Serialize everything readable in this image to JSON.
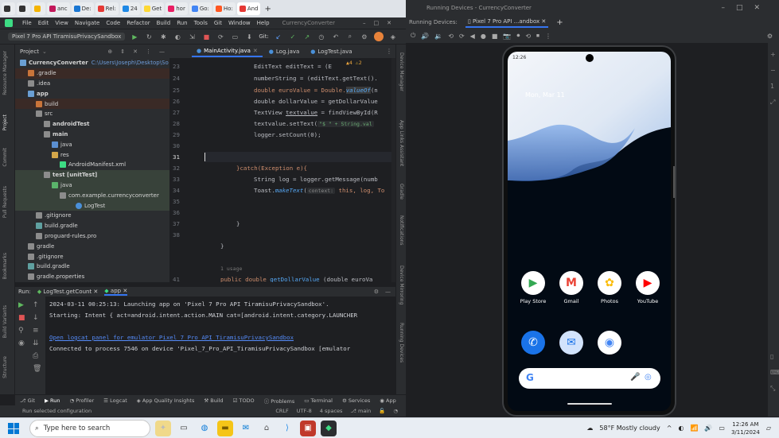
{
  "browser_tabs": [
    "anc",
    "De:",
    "Rel:",
    "24",
    "Get",
    "hor",
    "Go:",
    "Ho:",
    "And"
  ],
  "ide": {
    "menu": [
      "File",
      "Edit",
      "View",
      "Navigate",
      "Code",
      "Refactor",
      "Build",
      "Run",
      "Tools",
      "Git",
      "Window",
      "Help"
    ],
    "project_title": "CurrencyConverter",
    "device_selector": "Pixel 7 Pro API TiramisuPrivacySandbox",
    "git_label": "Git:",
    "project_panel_label": "Project",
    "tree": [
      {
        "label": "CurrencyConverter",
        "path": "C:\\Users\\Joseph\\Desktop\\So",
        "depth": 0
      },
      {
        "label": ".gradle",
        "depth": 1
      },
      {
        "label": ".idea",
        "depth": 1
      },
      {
        "label": "app",
        "depth": 1
      },
      {
        "label": "build",
        "depth": 2
      },
      {
        "label": "src",
        "depth": 2
      },
      {
        "label": "androidTest",
        "depth": 3
      },
      {
        "label": "main",
        "depth": 3
      },
      {
        "label": "java",
        "depth": 4
      },
      {
        "label": "res",
        "depth": 4
      },
      {
        "label": "AndroidManifest.xml",
        "depth": 4
      },
      {
        "label": "test [unitTest]",
        "depth": 3
      },
      {
        "label": "java",
        "depth": 4
      },
      {
        "label": "com.example.currencyconverter",
        "depth": 5
      },
      {
        "label": "LogTest",
        "depth": 6
      },
      {
        "label": ".gitignore",
        "depth": 2
      },
      {
        "label": "build.gradle",
        "depth": 2
      },
      {
        "label": "proguard-rules.pro",
        "depth": 2
      },
      {
        "label": "gradle",
        "depth": 1
      },
      {
        "label": ".gitignore",
        "depth": 1
      },
      {
        "label": "build.gradle",
        "depth": 1
      },
      {
        "label": "gradle.properties",
        "depth": 1
      }
    ],
    "editor_tabs": [
      "MainActivity.java",
      "Log.java",
      "LogTest.java"
    ],
    "inspection": {
      "warnings": "4",
      "weak": "2"
    },
    "line_numbers": [
      "23",
      "24",
      "25",
      "26",
      "27",
      "28",
      "29",
      "30",
      "31",
      "32",
      "33",
      "34",
      "35",
      "36",
      "37",
      "38",
      "",
      "41"
    ],
    "code": {
      "l23": "EditText editText = (E",
      "l24": "numberString = (editText.getText().",
      "l25a": "double euroValue = Double.",
      "l25b": "valueOf",
      "l25c": "(n",
      "l26": "double dollarValue = getDollarValue",
      "l27a": "TextView ",
      "l27b": "textvalue",
      "l27c": " = findViewById(R",
      "l28a": "textvalue",
      "l28b": ".setText(",
      "l28c": "\"$ \" + String.val",
      "l29": "logger.setCount(0);",
      "l32": "}catch(Exception e){",
      "l33": "String log = logger.getMessage(numb",
      "l34a": "Toast.",
      "l34b": "makeText",
      "l34c": "(",
      "l34d": "context:",
      "l34e": " this, log, To",
      "l36": "}",
      "l38": "}",
      "usage": "1 usage",
      "l41a": "public double ",
      "l41b": "getDollarValue",
      "l41c": " (double euroVa"
    },
    "run": {
      "label": "Run:",
      "tabs": [
        "LogTest.getCount",
        "app"
      ],
      "lines": [
        "2024-03-11 00:25:13: Launching app on 'Pixel 7 Pro API TiramisuPrivacySandbox'.",
        "Starting: Intent { act=android.intent.action.MAIN cat=[android.intent.category.LAUNCHER",
        "",
        "Open logcat panel for emulator Pixel 7 Pro API TiramisuPrivacySandbox",
        "Connected to process 7546 on device 'Pixel_7_Pro_API_TiramisuPrivacySandbox [emulator"
      ]
    },
    "tool_strip": [
      "Git",
      "Run",
      "Profiler",
      "Logcat",
      "App Quality Insights",
      "Build",
      "TODO",
      "Problems",
      "Terminal",
      "Services",
      "App"
    ],
    "status_left": "Run selected configuration",
    "status_right": [
      "CRLF",
      "UTF-8",
      "4 spaces",
      "main"
    ],
    "left_stripe": [
      "Resource Manager",
      "Project",
      "Commit",
      "Pull Requests",
      "Bookmarks",
      "Build Variants",
      "Structure"
    ],
    "right_stripe": [
      "Device Manager",
      "App Links Assistant",
      "Gradle",
      "Notifications",
      "Device Mirroring",
      "Running Devices"
    ]
  },
  "running_devices": {
    "title": "Running Devices - CurrencyConverter",
    "label": "Running Devices:",
    "tab": "Pixel 7 Pro API ...andbox",
    "phone": {
      "time": "12:26",
      "date_widget": "Mon, Mar 11",
      "apps_row1": [
        {
          "label": "Play Store",
          "glyph": "▶",
          "color": "#34a853"
        },
        {
          "label": "Gmail",
          "glyph": "M",
          "color": "#ea4335"
        },
        {
          "label": "Photos",
          "glyph": "✿",
          "color": "#fbbc05"
        },
        {
          "label": "YouTube",
          "glyph": "▶",
          "color": "#ff0000"
        }
      ],
      "apps_row2": [
        {
          "glyph": "✆",
          "color": "#1a73e8"
        },
        {
          "glyph": "✉",
          "color": "#1a73e8"
        },
        {
          "glyph": "◉",
          "color": "#4285f4"
        }
      ],
      "search_g": "G"
    }
  },
  "taskbar": {
    "search_placeholder": "Type here to search",
    "weather": "58°F  Mostly cloudy",
    "time": "12:26 AM",
    "date": "3/11/2024"
  }
}
